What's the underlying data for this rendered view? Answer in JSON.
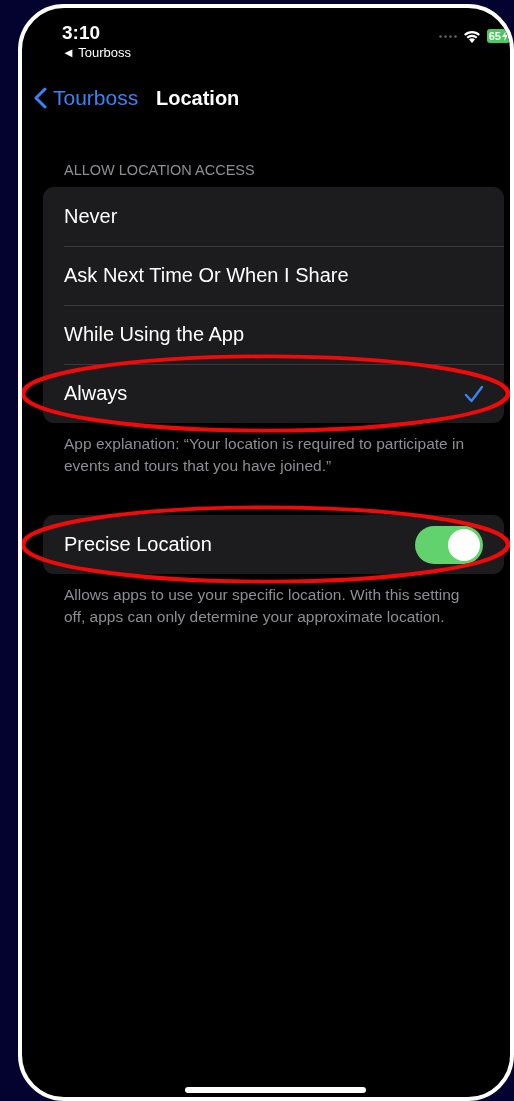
{
  "status_bar": {
    "time": "3:10",
    "back_app": "◄ Tourboss",
    "battery": "65"
  },
  "nav": {
    "back": "Tourboss",
    "title": "Location"
  },
  "section_header": "ALLOW LOCATION ACCESS",
  "options": [
    {
      "label": "Never",
      "selected": false
    },
    {
      "label": "Ask Next Time Or When I Share",
      "selected": false
    },
    {
      "label": "While Using the App",
      "selected": false
    },
    {
      "label": "Always",
      "selected": true
    }
  ],
  "options_footer": "App explanation: “Your location is required to participate in events and tours that you have joined.”",
  "precise": {
    "label": "Precise Location",
    "on": true
  },
  "precise_footer": "Allows apps to use your specific location. With this setting off, apps can only determine your approximate location."
}
